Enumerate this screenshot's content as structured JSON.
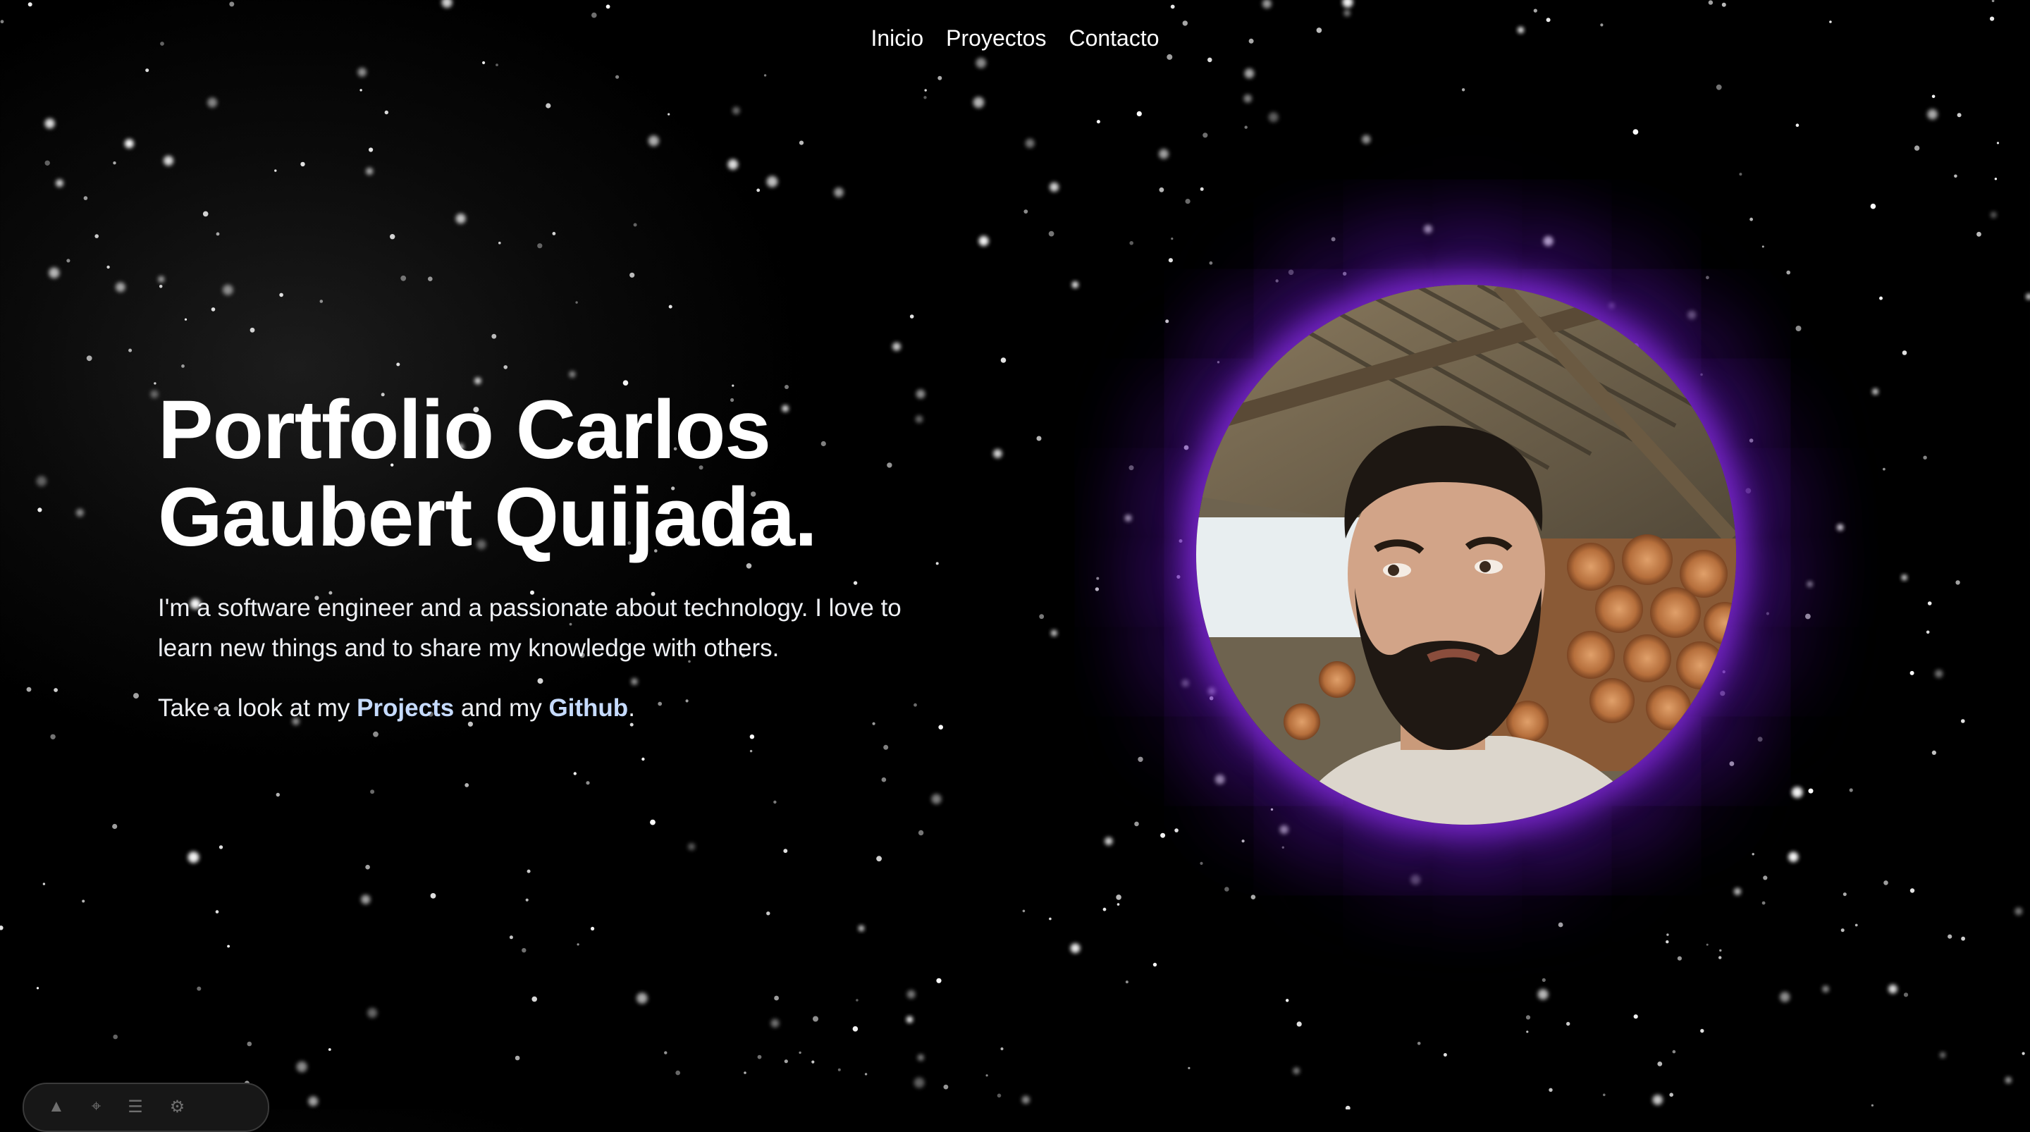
{
  "nav": {
    "items": [
      {
        "label": "Inicio"
      },
      {
        "label": "Proyectos"
      },
      {
        "label": "Contacto"
      }
    ]
  },
  "hero": {
    "title": "Portfolio Carlos Gaubert Quijada.",
    "description": "I'm a software engineer and a passionate about technology. I love to learn new things and to share my knowledge with others.",
    "cta": {
      "prefix": "Take a look at my ",
      "projects_label": "Projects",
      "middle": " and my ",
      "github_label": "Github",
      "suffix": "."
    }
  },
  "profile": {
    "glow_color": "#7c28d2"
  },
  "dock": {
    "icons": [
      "astro-icon",
      "inspect-icon",
      "menu-icon",
      "gear-icon"
    ]
  },
  "colors": {
    "background": "#000000",
    "link": "#c6dbff",
    "text": "#ffffff"
  }
}
